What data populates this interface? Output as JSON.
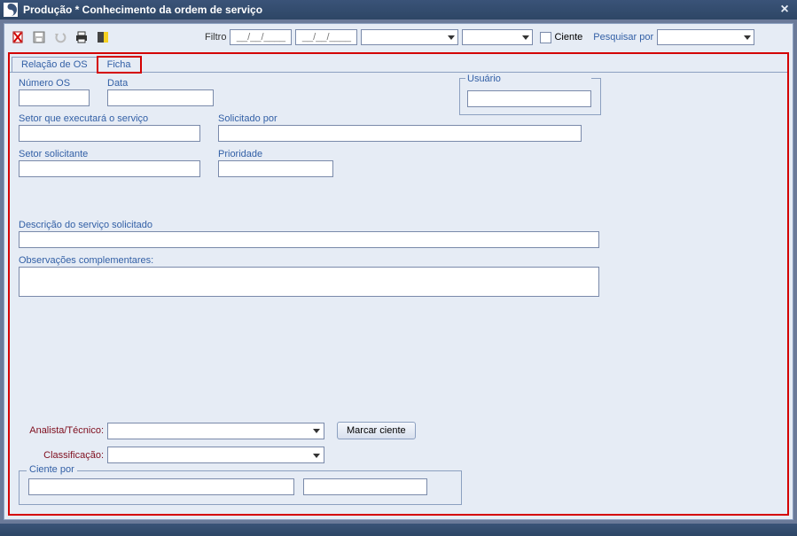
{
  "window": {
    "title": "Produção * Conhecimento da ordem de serviço"
  },
  "toolbar": {
    "filtro_label": "Filtro",
    "date_placeholder": "__/__/____",
    "ciente_label": "Ciente",
    "pesquisar_label": "Pesquisar por"
  },
  "tabs": {
    "relacao": "Relação de OS",
    "ficha": "Ficha"
  },
  "form": {
    "numero_os_label": "Número OS",
    "data_label": "Data",
    "usuario_label": "Usuário",
    "setor_exec_label": "Setor que executará o serviço",
    "solicitado_por_label": "Solicitado por",
    "setor_solic_label": "Setor solicitante",
    "prioridade_label": "Prioridade",
    "descricao_label": "Descrição do serviço solicitado",
    "obs_label": "Observações complementares:",
    "analista_label": "Analista/Técnico:",
    "classificacao_label": "Classificação:",
    "marcar_ciente_btn": "Marcar ciente",
    "ciente_por_label": "Ciente por"
  },
  "icons": {
    "app": "app-swirl",
    "cancel": "cancel-icon",
    "save": "save-icon",
    "undo": "undo-icon",
    "print": "print-icon",
    "exit": "exit-icon"
  }
}
